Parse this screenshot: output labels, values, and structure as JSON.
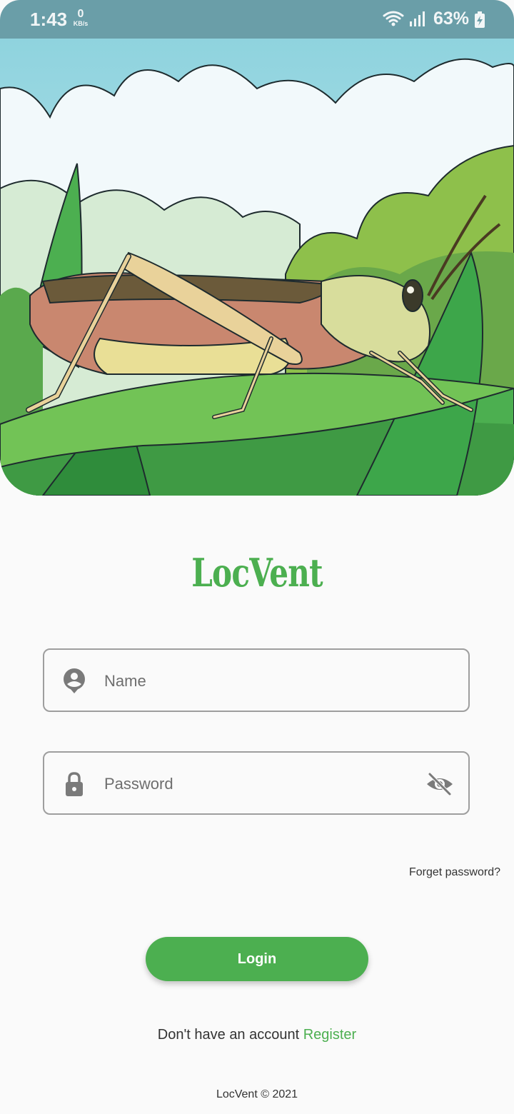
{
  "status_bar": {
    "time": "1:43",
    "network_speed_value": "0",
    "network_speed_unit": "KB/s",
    "battery_percent": "63%",
    "icons": [
      "wifi-icon",
      "signal-icon",
      "battery-charging-icon"
    ]
  },
  "hero": {
    "illustration": "grasshopper-on-grass-illustration"
  },
  "logo": {
    "text": "LocVent",
    "color": "#4caf50"
  },
  "form": {
    "name_placeholder": "Name",
    "name_icon": "person-pin-icon",
    "password_placeholder": "Password",
    "password_icon": "lock-icon",
    "visibility_icon": "visibility-off-icon",
    "forgot_password": "Forget password?",
    "login_label": "Login"
  },
  "register": {
    "prompt": "Don't have an account",
    "link": "Register"
  },
  "footer": {
    "text": "LocVent © 2021"
  },
  "colors": {
    "accent": "#4caf50",
    "status_bar": "#6a9ea8",
    "background": "#fafafa",
    "border": "#9e9e9e"
  }
}
